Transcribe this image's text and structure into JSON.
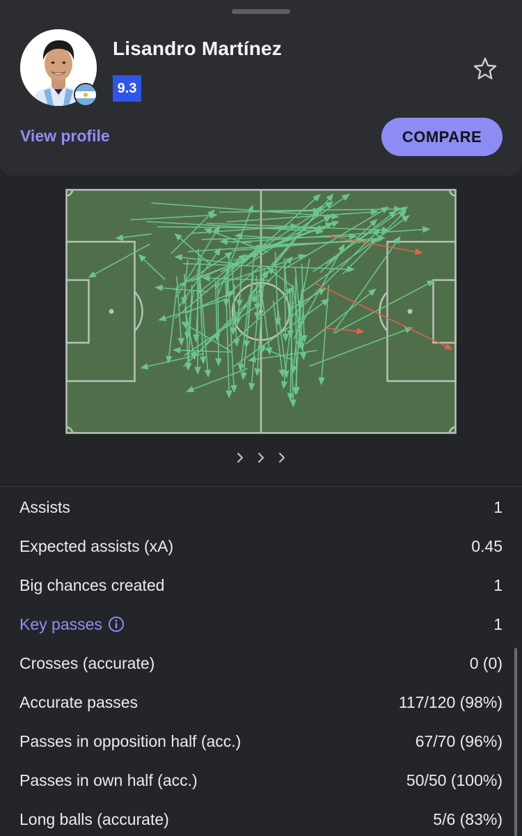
{
  "player": {
    "name": "Lisandro Martínez",
    "rating": "9.3",
    "flag_icon": "argentina-flag-icon",
    "view_profile_label": "View profile",
    "compare_label": "COMPARE"
  },
  "colors": {
    "background": "#232529",
    "card": "#2b2d31",
    "accent": "#8d8cf5",
    "rating_badge": "#2f54e8",
    "pitch": "#4f6f4a",
    "pitch_lines": "#b9c2b8",
    "successful_pass": "#6cc48e",
    "key_pass": "#e2624a"
  },
  "pass_map": {
    "successful_pass_count": 117,
    "unsuccessful_pass_count": 3
  },
  "pager": {
    "icons": [
      "chevron-right-icon",
      "chevron-right-icon",
      "chevron-right-icon"
    ]
  },
  "stats": [
    {
      "label": "Assists",
      "value": "1"
    },
    {
      "label": "Expected assists (xA)",
      "value": "0.45"
    },
    {
      "label": "Big chances created",
      "value": "1"
    },
    {
      "label": "Key passes",
      "value": "1",
      "link": true,
      "icon": "info-icon"
    },
    {
      "label": "Crosses (accurate)",
      "value": "0 (0)"
    },
    {
      "label": "Accurate passes",
      "value": "117/120 (98%)"
    },
    {
      "label": "Passes in opposition half (acc.)",
      "value": "67/70 (96%)"
    },
    {
      "label": "Passes in own half (acc.)",
      "value": "50/50 (100%)"
    },
    {
      "label": "Long balls (accurate)",
      "value": "5/6 (83%)"
    }
  ]
}
